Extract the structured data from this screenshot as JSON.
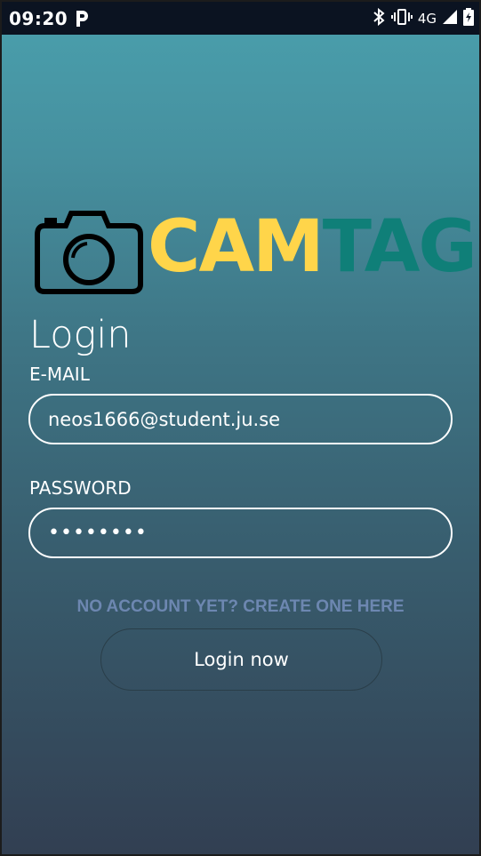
{
  "status_bar": {
    "time": "09:20",
    "notification_icon": "parking-p-icon",
    "bluetooth_icon": "bluetooth-icon",
    "vibrate_icon": "vibrate-icon",
    "network": "4G",
    "signal_icon": "signal-icon",
    "battery_icon": "battery-charging-icon"
  },
  "logo": {
    "icon": "camera-icon",
    "text_part1": "CAM",
    "text_part2": "TAG",
    "colors": {
      "cam": "#ffd54a",
      "tag": "#0f7f78"
    }
  },
  "login": {
    "title": "Login",
    "email_label": "E-MAIL",
    "email_value": "neos1666@student.ju.se",
    "password_label": "PASSWORD",
    "password_value": "••••••••",
    "signup_link": "NO ACCOUNT YET? CREATE ONE HERE",
    "submit_label": "Login now"
  },
  "colors": {
    "background_top": "#4aa0ad",
    "background_bottom": "#323f52",
    "link": "#6d87b1",
    "status_bar": "#0b1321"
  }
}
